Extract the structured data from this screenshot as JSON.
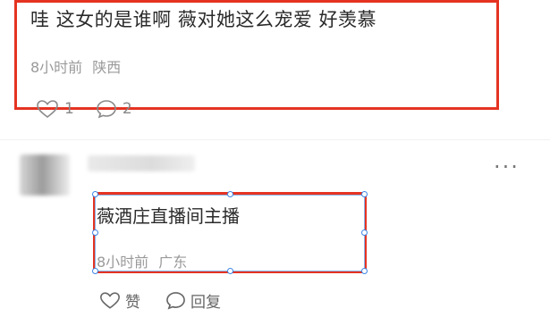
{
  "comment1": {
    "text": "哇 这女的是谁啊 薇对她这么宠爱 好羡慕",
    "time": "8小时前",
    "location": "陕西",
    "like_count": "1",
    "reply_count": "2",
    "like_icon": "heart-outline-icon",
    "reply_icon": "speech-bubble-icon"
  },
  "comment2": {
    "text": "薇酒庄直播间主播",
    "time": "8小时前",
    "location": "广东",
    "like_label": "赞",
    "reply_label": "回复",
    "more_label": "···"
  },
  "colors": {
    "highlight_box": "#e53321",
    "selection": "#3d86e6",
    "meta_text": "#9a9a9a"
  }
}
